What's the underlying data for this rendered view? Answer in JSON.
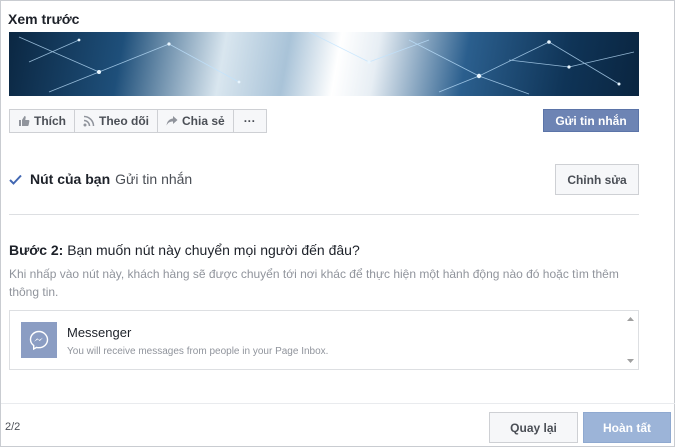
{
  "preview": {
    "title": "Xem trước"
  },
  "page_actions": {
    "like_label": "Thích",
    "follow_label": "Theo dõi",
    "share_label": "Chia sẻ",
    "more_label": "···",
    "send_message_label": "Gửi tin nhắn"
  },
  "your_button": {
    "label": "Nút của bạn",
    "value": "Gửi tin nhắn",
    "edit_label": "Chỉnh sửa"
  },
  "step": {
    "number_label": "Bước 2:",
    "question": "Bạn muốn nút này chuyển mọi người đến đâu?",
    "description": "Khi nhấp vào nút này, khách hàng sẽ được chuyển tới nơi khác để thực hiện một hành động nào đó hoặc tìm thêm thông tin."
  },
  "option": {
    "icon": "messenger-icon",
    "name": "Messenger",
    "description": "You will receive messages from people in your Page Inbox."
  },
  "footer": {
    "page_count": "2/2",
    "back_label": "Quay lại",
    "done_label": "Hoàn tất"
  },
  "colors": {
    "primary_button": "#6d84b4",
    "done_button_disabled": "#9cb4d8",
    "messenger_icon_bg": "#8b9dc3",
    "check_color": "#4267b2"
  }
}
